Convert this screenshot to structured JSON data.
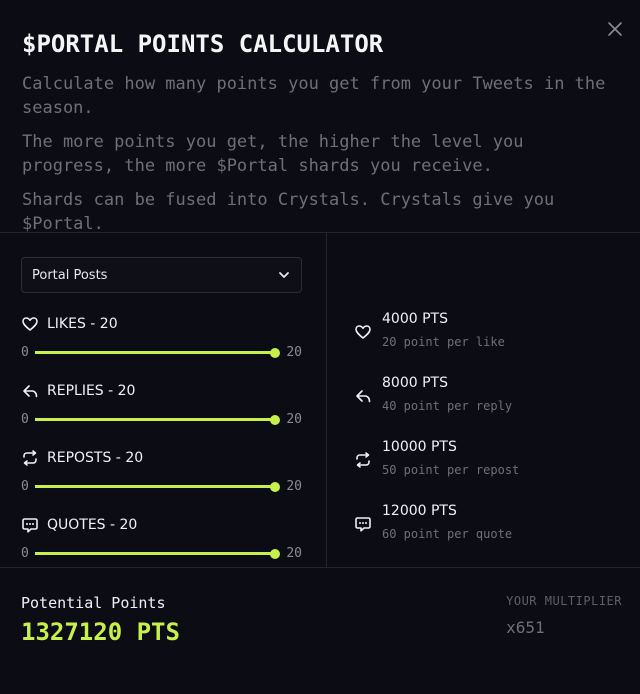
{
  "header": {
    "title": "$PORTAL POINTS CALCULATOR",
    "desc1": "Calculate how many points you get from your Tweets in the season.",
    "desc2": "The more points you get, the higher the level you progress, the more $Portal shards you receive.",
    "desc3": "Shards can be fused into Crystals. Crystals give you $Portal."
  },
  "select": {
    "value": "Portal Posts"
  },
  "metrics": [
    {
      "label": "LIKES - 20",
      "min": "0",
      "max": "20",
      "icon": "heart-icon",
      "value": 20
    },
    {
      "label": "REPLIES - 20",
      "min": "0",
      "max": "20",
      "icon": "reply-icon",
      "value": 20
    },
    {
      "label": "REPOSTS - 20",
      "min": "0",
      "max": "20",
      "icon": "repost-icon",
      "value": 20
    },
    {
      "label": "QUOTES - 20",
      "min": "0",
      "max": "20",
      "icon": "quote-icon",
      "value": 20
    }
  ],
  "stats": [
    {
      "pts": "4000 PTS",
      "sub": "20 point per like"
    },
    {
      "pts": "8000 PTS",
      "sub": "40 point per reply"
    },
    {
      "pts": "10000 PTS",
      "sub": "50 point per repost"
    },
    {
      "pts": "12000 PTS",
      "sub": "60 point per quote"
    }
  ],
  "footer": {
    "potential_label": "Potential Points",
    "potential_value": "1327120 PTS",
    "multiplier_label": "YOUR MULTIPLIER",
    "multiplier_value": "x651"
  },
  "colors": {
    "accent": "#c8f04a",
    "background": "#0c0c14",
    "muted": "#6e6f7c"
  }
}
